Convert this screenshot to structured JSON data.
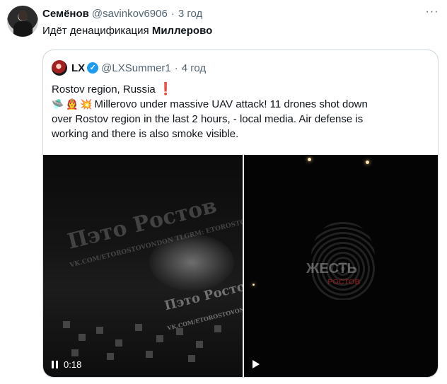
{
  "tweet": {
    "author_name": "Семёнов",
    "handle": "@savinkov6906",
    "separator": "·",
    "time": "3 год",
    "more_icon": "more-icon",
    "text_prefix": "Идёт денацификация",
    "text_bold": "Миллерово"
  },
  "quote": {
    "author_name": "LX",
    "handle": "@LXSummer1",
    "separator": "·",
    "time": "4 год",
    "line1": "Rostov region, Russia",
    "line1_emoji": "❗",
    "emojis": [
      "🛸",
      "🧑‍🚒",
      "💥"
    ],
    "line2": " Millerovo under massive UAV attack! 11 drones shot down",
    "line3": "over Rostov region in the last 2 hours, - local media. Air defense is",
    "line4": "working and there is also smoke visible."
  },
  "media": {
    "left_video": {
      "time": "0:18",
      "control_icon": "pause-icon",
      "watermark_main": "Пэто Ростов",
      "watermark_sub": "VK.COM/ETOROSTOVONDON TLGRM: ETOROSTOV",
      "watermark_small": "Пэто Ростов",
      "watermark_small_sub": "VK.COM/ETOROSTOVONDON TLGRM: ETOROSTOV"
    },
    "right_video": {
      "control_icon": "play-icon",
      "watermark_main": "ЖЕСТЬ",
      "watermark_sub": "РОСТОВ"
    }
  },
  "colors": {
    "text": "#0f1419",
    "muted": "#536471",
    "border": "#cfd9de",
    "verified": "#1d9bf0"
  }
}
